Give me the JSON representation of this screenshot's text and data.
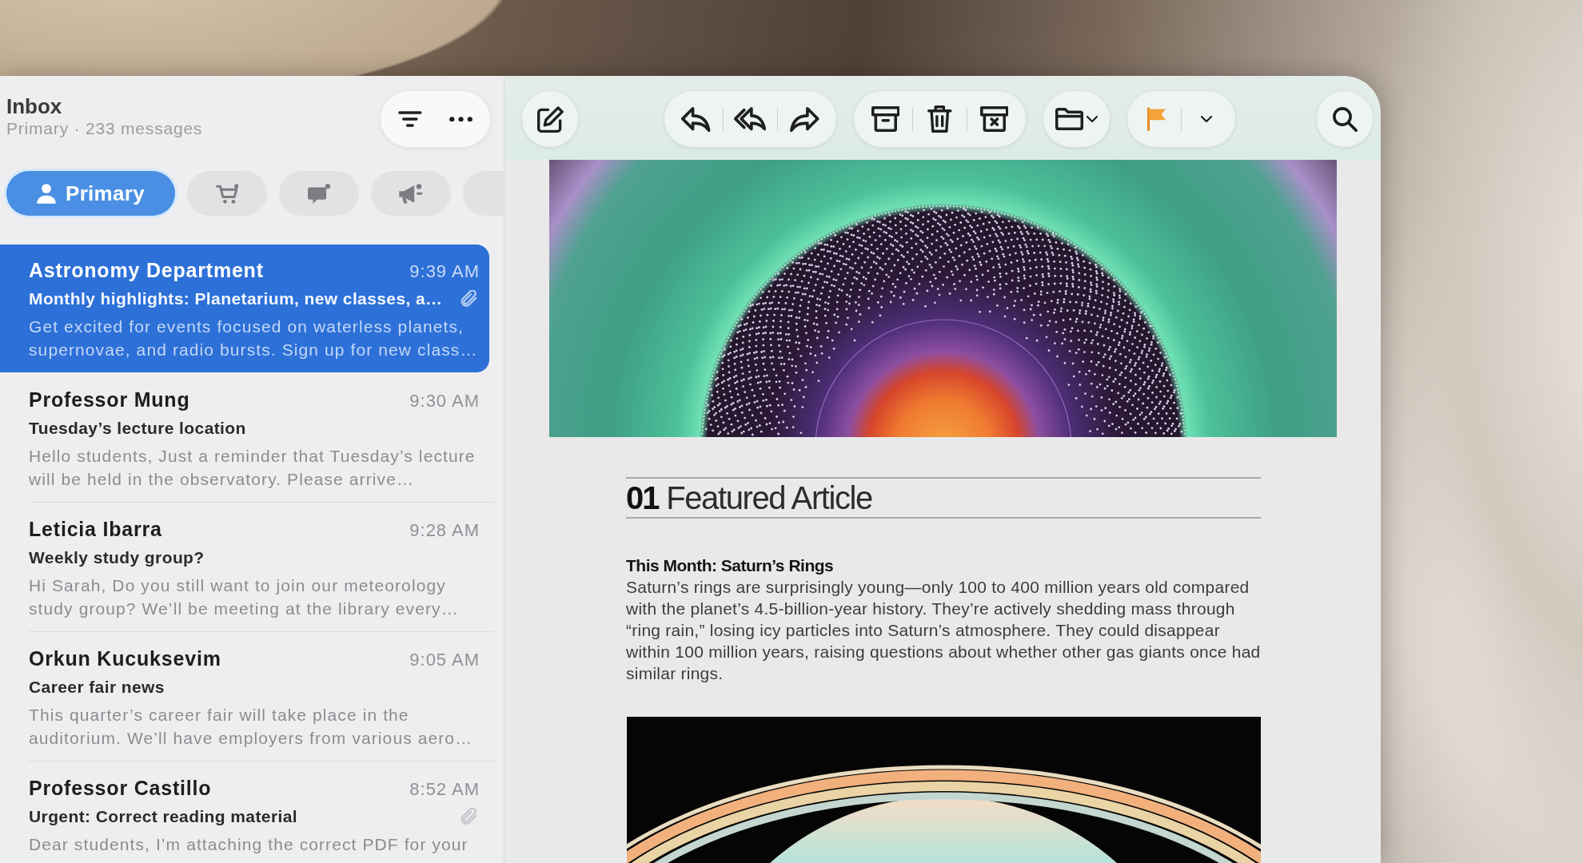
{
  "mailbox": {
    "title": "Inbox",
    "subtitle": "Primary · 233 messages"
  },
  "category_tabs": [
    {
      "label": "Primary",
      "selected": true
    },
    {
      "selected": false
    },
    {
      "selected": false
    },
    {
      "selected": false
    },
    {
      "selected": false
    }
  ],
  "messages": [
    {
      "sender": "Astronomy Department",
      "time": "9:39 AM",
      "subject": "Monthly highlights: Planetarium, new classes, a…",
      "preview": "Get excited for events focused on waterless planets, supernovae, and radio bursts. Sign up for new class…",
      "attachment": true,
      "selected": true
    },
    {
      "sender": "Professor Mung",
      "time": "9:30 AM",
      "subject": "Tuesday’s lecture location",
      "preview": "Hello students, Just a reminder that Tuesday’s lecture will be held in the observatory. Please arrive…",
      "attachment": false,
      "selected": false
    },
    {
      "sender": "Leticia Ibarra",
      "time": "9:28 AM",
      "subject": "Weekly study group?",
      "preview": "Hi Sarah, Do you still want to join our meteorology study group? We’ll be meeting at the library every…",
      "attachment": false,
      "selected": false
    },
    {
      "sender": "Orkun Kucuksevim",
      "time": "9:05 AM",
      "subject": "Career fair news",
      "preview": "This quarter’s career fair will take place in the auditorium. We’ll have employers from various aero…",
      "attachment": false,
      "selected": false
    },
    {
      "sender": "Professor Castillo",
      "time": "8:52 AM",
      "subject": "Urgent: Correct reading material",
      "preview": "Dear students, I’m attaching the correct PDF for your",
      "attachment": true,
      "selected": false
    }
  ],
  "article": {
    "heading": "**01** Featured Article",
    "subtitle": "This Month: Saturn’s Rings",
    "body": "Saturn’s rings are surprisingly young—only 100 to 400 million years old compared with the planet’s 4.5-billion-year history. They’re actively shedding mass through “ring rain,” losing icy particles into Saturn’s atmosphere. They could disappear within 100 million years, raising questions about whether other gas giants once had similar rings."
  }
}
